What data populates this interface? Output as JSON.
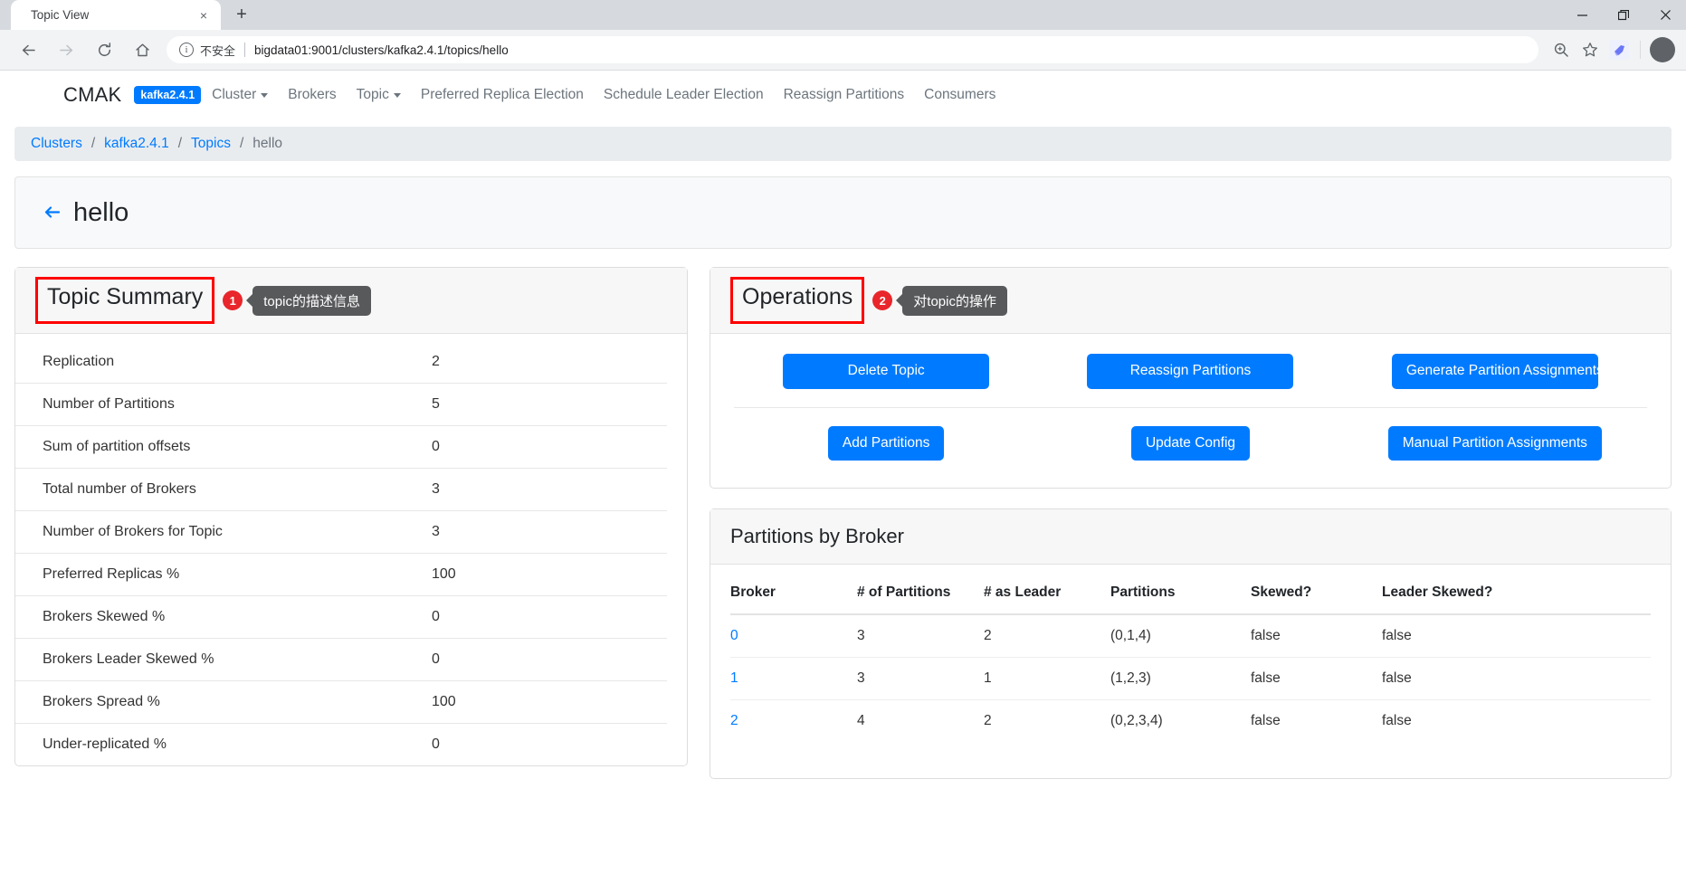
{
  "browser": {
    "tab_title": "Topic View",
    "tab_close": "×",
    "new_tab": "+",
    "minimize": "—",
    "maximize": "❐",
    "close": "✕",
    "back": "←",
    "forward": "→",
    "reload": "↻",
    "home": "⌂",
    "info_glyph": "i",
    "security_label": "不安全",
    "url": "bigdata01:9001/clusters/kafka2.4.1/topics/hello",
    "zoom_icon": "⊕",
    "bookmark_icon": "☆",
    "extension_icon": "➤",
    "profile_icon": "●"
  },
  "navbar": {
    "brand": "CMAK",
    "cluster_badge": "kafka2.4.1",
    "links": [
      {
        "label": "Cluster",
        "caret": true
      },
      {
        "label": "Brokers",
        "caret": false
      },
      {
        "label": "Topic",
        "caret": true
      },
      {
        "label": "Preferred Replica Election",
        "caret": false
      },
      {
        "label": "Schedule Leader Election",
        "caret": false
      },
      {
        "label": "Reassign Partitions",
        "caret": false
      },
      {
        "label": "Consumers",
        "caret": false
      }
    ]
  },
  "breadcrumb": {
    "items": [
      "Clusters",
      "kafka2.4.1",
      "Topics",
      "hello"
    ],
    "separator": "/"
  },
  "page": {
    "back_arrow": "←",
    "title": "hello"
  },
  "topic_summary": {
    "title": "Topic Summary",
    "annotation_number": "1",
    "annotation_text": "topic的描述信息",
    "rows": [
      {
        "label": "Replication",
        "value": "2"
      },
      {
        "label": "Number of Partitions",
        "value": "5"
      },
      {
        "label": "Sum of partition offsets",
        "value": "0"
      },
      {
        "label": "Total number of Brokers",
        "value": "3"
      },
      {
        "label": "Number of Brokers for Topic",
        "value": "3"
      },
      {
        "label": "Preferred Replicas %",
        "value": "100"
      },
      {
        "label": "Brokers Skewed %",
        "value": "0"
      },
      {
        "label": "Brokers Leader Skewed %",
        "value": "0"
      },
      {
        "label": "Brokers Spread %",
        "value": "100"
      },
      {
        "label": "Under-replicated %",
        "value": "0"
      }
    ]
  },
  "operations": {
    "title": "Operations",
    "annotation_number": "2",
    "annotation_text": "对topic的操作",
    "row1": [
      "Delete Topic",
      "Reassign Partitions",
      "Generate Partition Assignments"
    ],
    "row2": [
      "Add Partitions",
      "Update Config",
      "Manual Partition Assignments"
    ]
  },
  "partitions_by_broker": {
    "title": "Partitions by Broker",
    "columns": [
      "Broker",
      "# of Partitions",
      "# as Leader",
      "Partitions",
      "Skewed?",
      "Leader Skewed?"
    ],
    "rows": [
      {
        "broker": "0",
        "num_partitions": "3",
        "num_as_leader": "2",
        "partitions": "(0,1,4)",
        "skewed": "false",
        "leader_skewed": "false"
      },
      {
        "broker": "1",
        "num_partitions": "3",
        "num_as_leader": "1",
        "partitions": "(1,2,3)",
        "skewed": "false",
        "leader_skewed": "false"
      },
      {
        "broker": "2",
        "num_partitions": "4",
        "num_as_leader": "2",
        "partitions": "(0,2,3,4)",
        "skewed": "false",
        "leader_skewed": "false"
      }
    ]
  },
  "colors": {
    "primary": "#007bff",
    "annotation_red": "#ff0000",
    "annotation_badge": "#e8262b",
    "tooltip_bg": "#58595b"
  }
}
